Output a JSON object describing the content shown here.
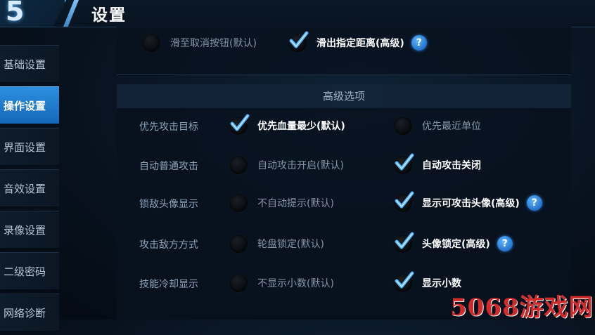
{
  "header": {
    "back_glyph": "5",
    "title": "设置"
  },
  "sidebar": {
    "items": [
      {
        "label": "基础设置",
        "active": false
      },
      {
        "label": "操作设置",
        "active": true
      },
      {
        "label": "界面设置",
        "active": false
      },
      {
        "label": "音效设置",
        "active": false
      },
      {
        "label": "录像设置",
        "active": false
      },
      {
        "label": "二级密码",
        "active": false
      },
      {
        "label": "网络诊断",
        "active": false
      }
    ]
  },
  "top_options": {
    "option_a": {
      "label": "滑至取消按钮(默认)",
      "checked": false
    },
    "option_b": {
      "label": "滑出指定距离(高级)",
      "checked": true
    },
    "help": "?"
  },
  "advanced": {
    "title": "高级选项",
    "rows": [
      {
        "label": "优先攻击目标",
        "left": {
          "label": "优先血量最少(默认)",
          "checked": true
        },
        "right": {
          "label": "优先最近单位",
          "checked": false
        }
      },
      {
        "label": "自动普通攻击",
        "left": {
          "label": "自动攻击开启(默认)",
          "checked": false
        },
        "right": {
          "label": "自动攻击关闭",
          "checked": true
        }
      },
      {
        "label": "锁敌头像显示",
        "left": {
          "label": "不自动提示(默认)",
          "checked": false
        },
        "right": {
          "label": "显示可攻击头像(高级)",
          "checked": true,
          "help": "?"
        }
      },
      {
        "label": "攻击敌方方式",
        "left": {
          "label": "轮盘锁定(默认)",
          "checked": false
        },
        "right": {
          "label": "头像锁定(高级)",
          "checked": true,
          "help": "?"
        }
      },
      {
        "label": "技能冷却显示",
        "left": {
          "label": "不显示小数(默认)",
          "checked": false
        },
        "right": {
          "label": "显示小数",
          "checked": true
        }
      }
    ]
  },
  "watermark": "5068游戏网",
  "colors": {
    "accent": "#2d8fe0",
    "check": "#4fb0ff",
    "help": "#1d6ac4"
  }
}
